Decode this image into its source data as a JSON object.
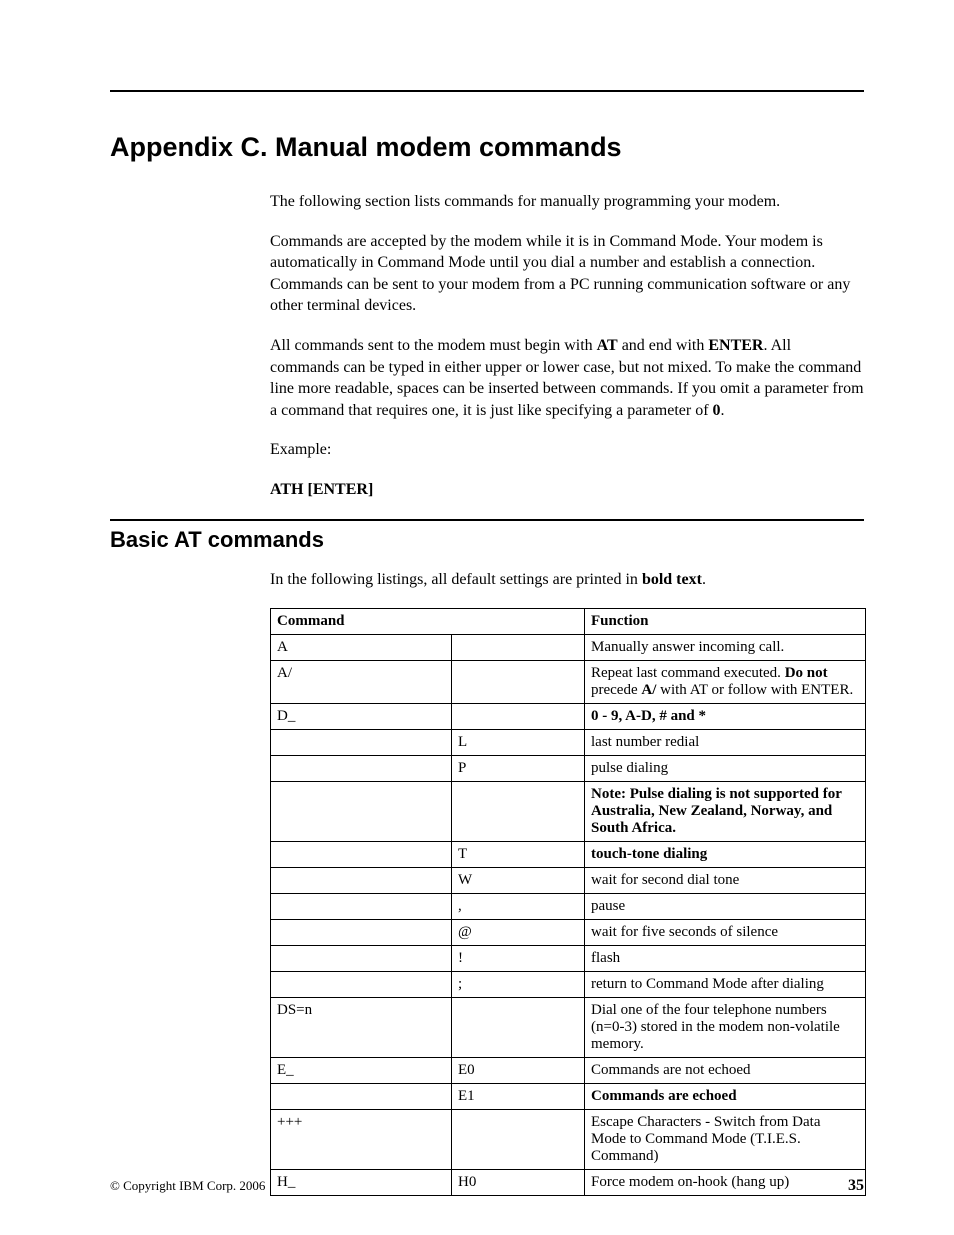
{
  "title": "Appendix C. Manual modem commands",
  "intro": {
    "p1": "The following section lists commands for manually programming your modem.",
    "p2a": "Commands are accepted by the modem while it is in Command Mode. Your modem is automatically in Command Mode until you dial a number and establish a connection. Commands can be sent to your modem from a PC running communication software or any other terminal devices.",
    "p3a": "All commands sent to the modem must begin with ",
    "p3b": "AT",
    "p3c": " and end with ",
    "p3d": "ENTER",
    "p3e": ". All commands can be typed in either upper or lower case, but not mixed. To make the command line more readable, spaces can be inserted between commands. If you omit a parameter from a command that requires one, it is just like specifying a parameter of ",
    "p3f": "0",
    "p3g": ".",
    "p4": "Example:",
    "p5": "ATH [ENTER]"
  },
  "section_title": "Basic AT commands",
  "section_intro_a": "In the following listings, all default settings are printed in ",
  "section_intro_b": "bold text",
  "section_intro_c": ".",
  "table": {
    "head": {
      "command": "Command",
      "function": "Function"
    },
    "rows": [
      {
        "cmd": "A",
        "cmd_bold": true,
        "arg": "",
        "arg_bold": false,
        "fn_parts": [
          {
            "t": "Manually answer incoming call.",
            "b": false
          }
        ]
      },
      {
        "cmd": "A/",
        "cmd_bold": true,
        "arg": "",
        "arg_bold": false,
        "fn_parts": [
          {
            "t": "Repeat last command executed. ",
            "b": false
          },
          {
            "t": "Do not",
            "b": true
          },
          {
            "t": " precede ",
            "b": false
          },
          {
            "t": "A/",
            "b": true
          },
          {
            "t": " with AT or follow with ENTER.",
            "b": false
          }
        ]
      },
      {
        "cmd": "D_",
        "cmd_bold": true,
        "arg": "",
        "arg_bold": false,
        "fn_parts": [
          {
            "t": "0 - 9, A-D, # and *",
            "b": true
          }
        ]
      },
      {
        "cmd": "",
        "cmd_bold": false,
        "arg": "L",
        "arg_bold": false,
        "fn_parts": [
          {
            "t": "last number redial",
            "b": false
          }
        ]
      },
      {
        "cmd": "",
        "cmd_bold": false,
        "arg": "P",
        "arg_bold": false,
        "fn_parts": [
          {
            "t": "pulse dialing",
            "b": false
          }
        ]
      },
      {
        "cmd": "",
        "cmd_bold": false,
        "arg": "",
        "arg_bold": false,
        "fn_parts": [
          {
            "t": "Note: Pulse dialing is not supported for Australia, New Zealand, Norway, and South Africa.",
            "b": true
          }
        ]
      },
      {
        "cmd": "",
        "cmd_bold": false,
        "arg": "T",
        "arg_bold": true,
        "fn_parts": [
          {
            "t": "touch-tone dialing",
            "b": true
          }
        ]
      },
      {
        "cmd": "",
        "cmd_bold": false,
        "arg": "W",
        "arg_bold": false,
        "fn_parts": [
          {
            "t": "wait for second dial tone",
            "b": false
          }
        ]
      },
      {
        "cmd": "",
        "cmd_bold": false,
        "arg": ",",
        "arg_bold": false,
        "fn_parts": [
          {
            "t": "pause",
            "b": false
          }
        ]
      },
      {
        "cmd": "",
        "cmd_bold": false,
        "arg": "@",
        "arg_bold": false,
        "fn_parts": [
          {
            "t": "wait for five seconds of silence",
            "b": false
          }
        ]
      },
      {
        "cmd": "",
        "cmd_bold": false,
        "arg": "!",
        "arg_bold": false,
        "fn_parts": [
          {
            "t": "flash",
            "b": false
          }
        ]
      },
      {
        "cmd": "",
        "cmd_bold": false,
        "arg": ";",
        "arg_bold": false,
        "fn_parts": [
          {
            "t": "return to Command Mode after dialing",
            "b": false
          }
        ]
      },
      {
        "cmd": "DS=n",
        "cmd_bold": true,
        "arg": "",
        "arg_bold": false,
        "fn_parts": [
          {
            "t": "Dial one of the four telephone numbers (n=0-3) stored in the modem non-volatile memory.",
            "b": false
          }
        ]
      },
      {
        "cmd": "E_",
        "cmd_bold": true,
        "arg": "E0",
        "arg_bold": false,
        "fn_parts": [
          {
            "t": "Commands are not echoed",
            "b": false
          }
        ]
      },
      {
        "cmd": "",
        "cmd_bold": false,
        "arg": "E1",
        "arg_bold": true,
        "fn_parts": [
          {
            "t": "Commands are echoed",
            "b": true
          }
        ]
      },
      {
        "cmd": "+++",
        "cmd_bold": true,
        "arg": "",
        "arg_bold": false,
        "fn_parts": [
          {
            "t": "Escape Characters - Switch from Data Mode to Command Mode (T.I.E.S. Command)",
            "b": false
          }
        ]
      },
      {
        "cmd": "H_",
        "cmd_bold": true,
        "arg": "H0",
        "arg_bold": false,
        "fn_parts": [
          {
            "t": "Force modem on-hook (hang up)",
            "b": false
          }
        ]
      }
    ]
  },
  "footer": {
    "copyright": "© Copyright IBM Corp. 2006",
    "page": "35"
  }
}
